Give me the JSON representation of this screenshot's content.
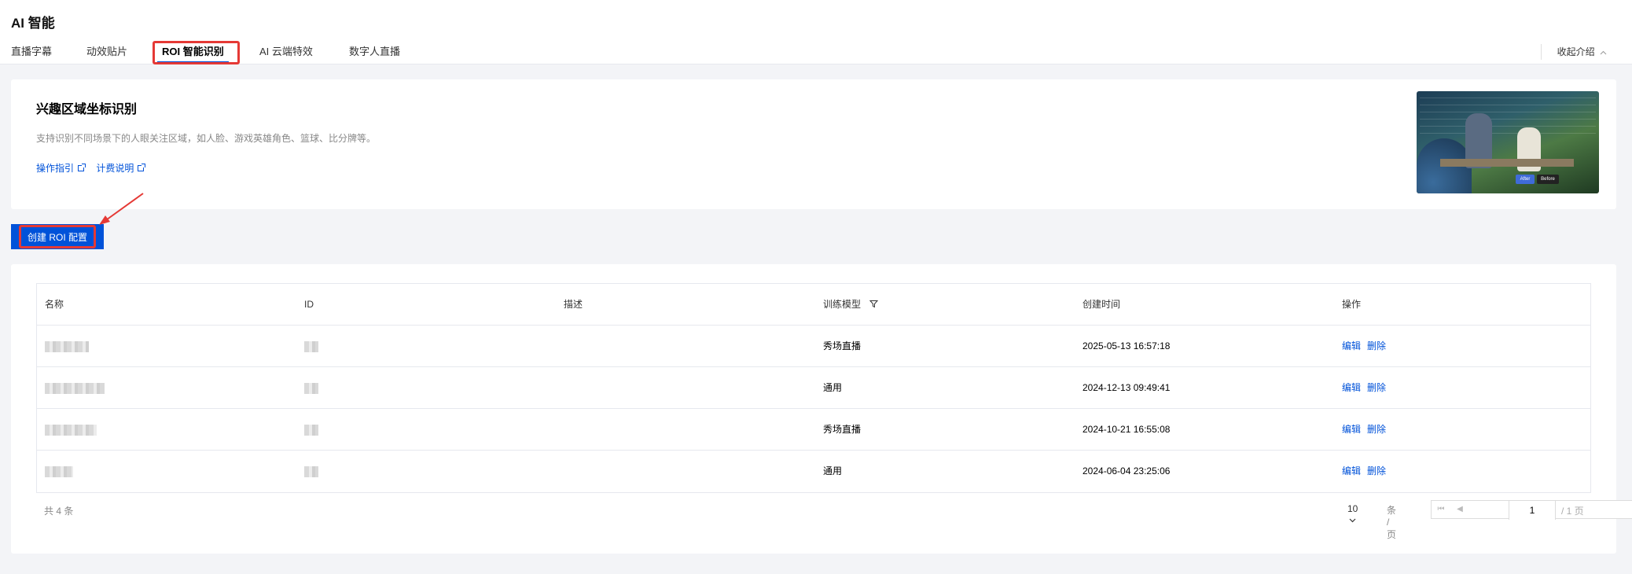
{
  "app": {
    "title": "AI 智能"
  },
  "tabs": [
    {
      "label": "直播字幕"
    },
    {
      "label": "动效贴片"
    },
    {
      "label": "ROI 智能识别",
      "active": true
    },
    {
      "label": "AI 云端特效"
    },
    {
      "label": "数字人直播"
    }
  ],
  "collapse_label": "收起介绍",
  "intro": {
    "title": "兴趣区域坐标识别",
    "description": "支持识别不同场景下的人眼关注区域，如人脸、游戏英雄角色、篮球、比分牌等。",
    "links": [
      {
        "label": "操作指引"
      },
      {
        "label": "计费说明"
      }
    ],
    "preview_buttons": [
      "After",
      "Before"
    ]
  },
  "create_button": "创建 ROI 配置",
  "table": {
    "columns": [
      "名称",
      "ID",
      "描述",
      "训练模型",
      "创建时间",
      "操作"
    ],
    "rows": [
      {
        "model": "秀场直播",
        "created": "2025-05-13 16:57:18"
      },
      {
        "model": "通用",
        "created": "2024-12-13 09:49:41"
      },
      {
        "model": "秀场直播",
        "created": "2024-10-21 16:55:08"
      },
      {
        "model": "通用",
        "created": "2024-06-04 23:25:06"
      }
    ],
    "actions": {
      "edit": "编辑",
      "delete": "删除"
    }
  },
  "footer": {
    "total": "共 4 条",
    "page_size": "10",
    "per_page_label": "条 / 页",
    "current_page": "1",
    "total_pages": "/ 1 页"
  },
  "colors": {
    "accent": "#0052d9",
    "highlight": "#e53935"
  }
}
